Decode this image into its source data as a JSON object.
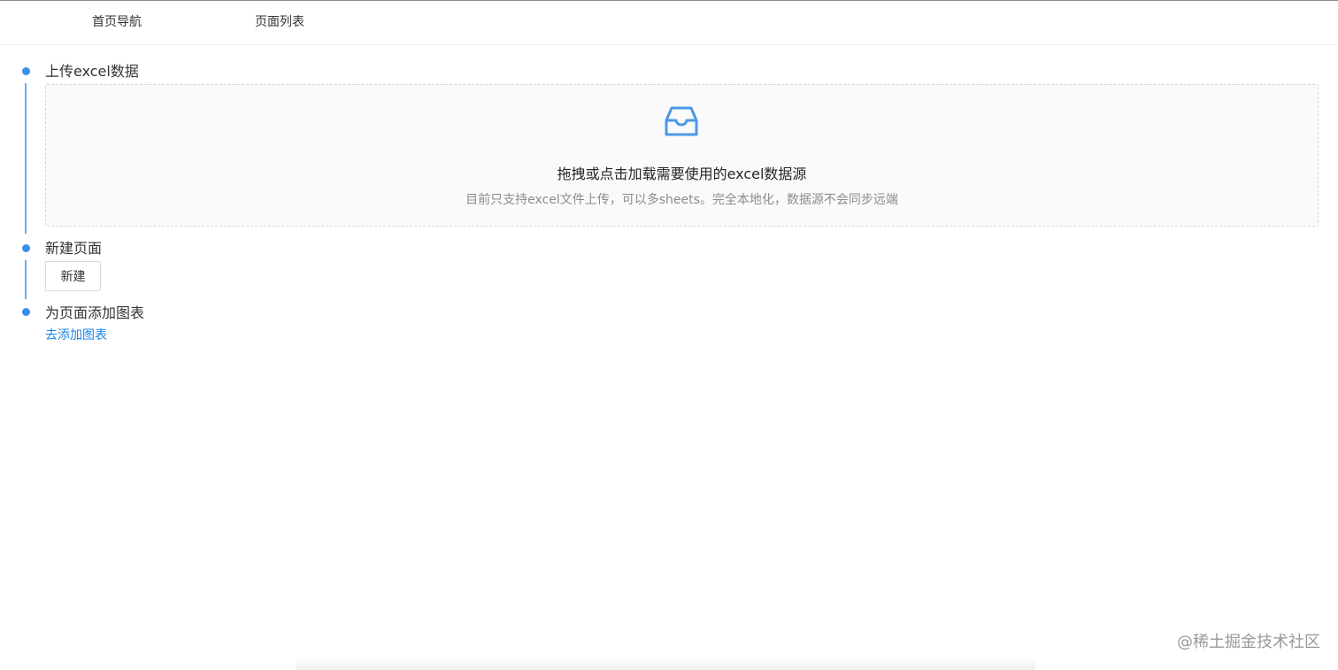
{
  "nav": {
    "home": "首页导航",
    "pages": "页面列表"
  },
  "steps": [
    {
      "title": "上传excel数据",
      "dropzone": {
        "icon": "inbox-icon",
        "main_text": "拖拽或点击加载需要使用的excel数据源",
        "hint_text": "目前只支持excel文件上传，可以多sheets。完全本地化，数据源不会同步远端"
      }
    },
    {
      "title": "新建页面",
      "button_label": "新建"
    },
    {
      "title": "为页面添加图表",
      "link_label": "去添加图表"
    }
  ],
  "watermark": "@稀土掘金技术社区",
  "colors": {
    "accent": "#3b8fe8",
    "link": "#1b84e7",
    "icon": "#4a9ae6"
  }
}
